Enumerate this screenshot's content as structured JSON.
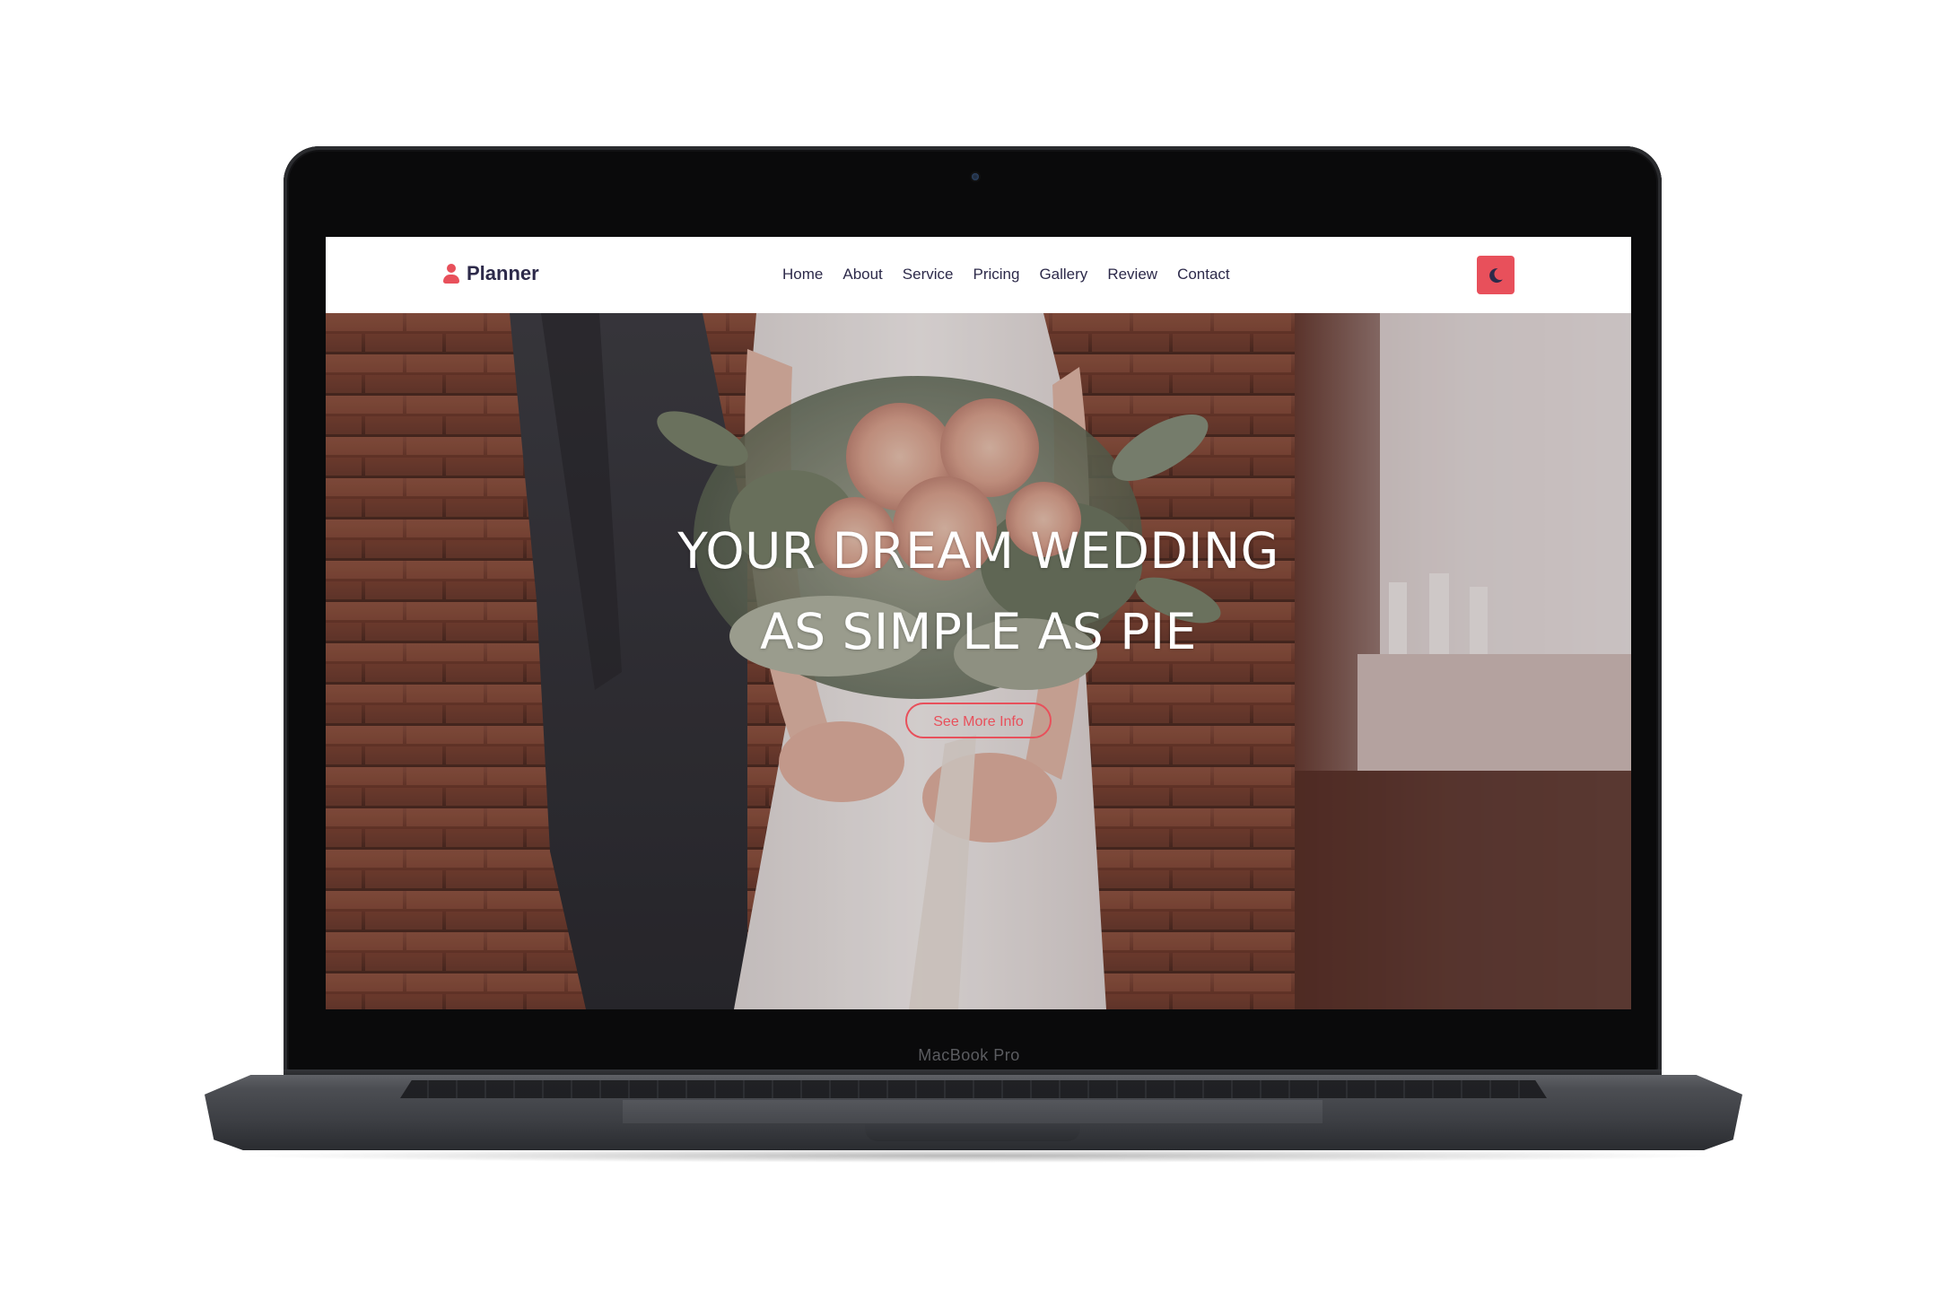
{
  "device": {
    "label": "MacBook Pro"
  },
  "brand": {
    "name": "Planner",
    "icon": "person-icon",
    "color": "#e8505b"
  },
  "nav": {
    "items": [
      {
        "label": "Home"
      },
      {
        "label": "About"
      },
      {
        "label": "Service"
      },
      {
        "label": "Pricing"
      },
      {
        "label": "Gallery"
      },
      {
        "label": "Review"
      },
      {
        "label": "Contact"
      }
    ],
    "theme_toggle_icon": "moon-icon"
  },
  "hero": {
    "title_line1": "YOUR DREAM WEDDING",
    "title_line2": "AS SIMPLE AS PIE",
    "button_label": "See More Info",
    "background": "wedding-couple-bouquet-photo"
  },
  "colors": {
    "accent": "#e8505b",
    "text_dark": "#2d2a4a"
  }
}
